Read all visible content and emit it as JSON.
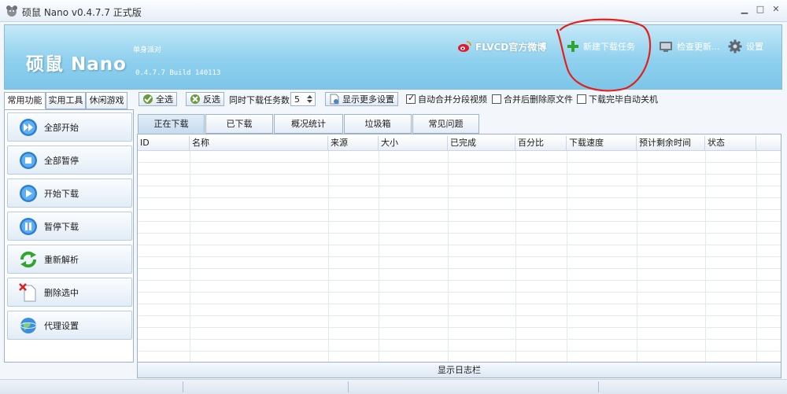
{
  "window": {
    "title": "硕鼠 Nano v0.4.7.7 正式版"
  },
  "header": {
    "logo": "硕鼠 Nano",
    "subtitle": "单身派对",
    "build": "0.4.7.7 Build 140113",
    "weibo": "FLVCD官方微博",
    "new_task": "新建下载任务",
    "check_update": "检查更新...",
    "settings": "设置"
  },
  "left_tabs": [
    "常用功能",
    "实用工具",
    "休闲游戏"
  ],
  "left_buttons": [
    {
      "label": "全部开始",
      "icon": "fast-forward-icon"
    },
    {
      "label": "全部暂停",
      "icon": "stop-icon"
    },
    {
      "label": "开始下载",
      "icon": "play-icon"
    },
    {
      "label": "暂停下载",
      "icon": "pause-icon"
    },
    {
      "label": "重新解析",
      "icon": "refresh-icon"
    },
    {
      "label": "删除选中",
      "icon": "delete-file-icon"
    },
    {
      "label": "代理设置",
      "icon": "globe-icon"
    }
  ],
  "toolbar": {
    "select_all": "全选",
    "invert": "反选",
    "tasks_label": "同时下载任务数:",
    "tasks_value": "5",
    "more_settings": "显示更多设置",
    "auto_merge": "自动合并分段视频",
    "auto_merge_checked": true,
    "delete_after_merge": "合并后删除原文件",
    "delete_after_merge_checked": false,
    "shutdown": "下载完毕自动关机",
    "shutdown_checked": false
  },
  "main_tabs": [
    "正在下载",
    "已下载",
    "概况统计",
    "垃圾箱",
    "常见问题"
  ],
  "active_main_tab": "正在下载",
  "columns": [
    "ID",
    "名称",
    "来源",
    "大小",
    "已完成",
    "百分比",
    "下载速度",
    "预计剩余时间",
    "状态"
  ],
  "rows": [],
  "log_bar": "显示日志栏",
  "colors": {
    "banner": "#8fd0ee",
    "annotation": "#e2211c"
  }
}
